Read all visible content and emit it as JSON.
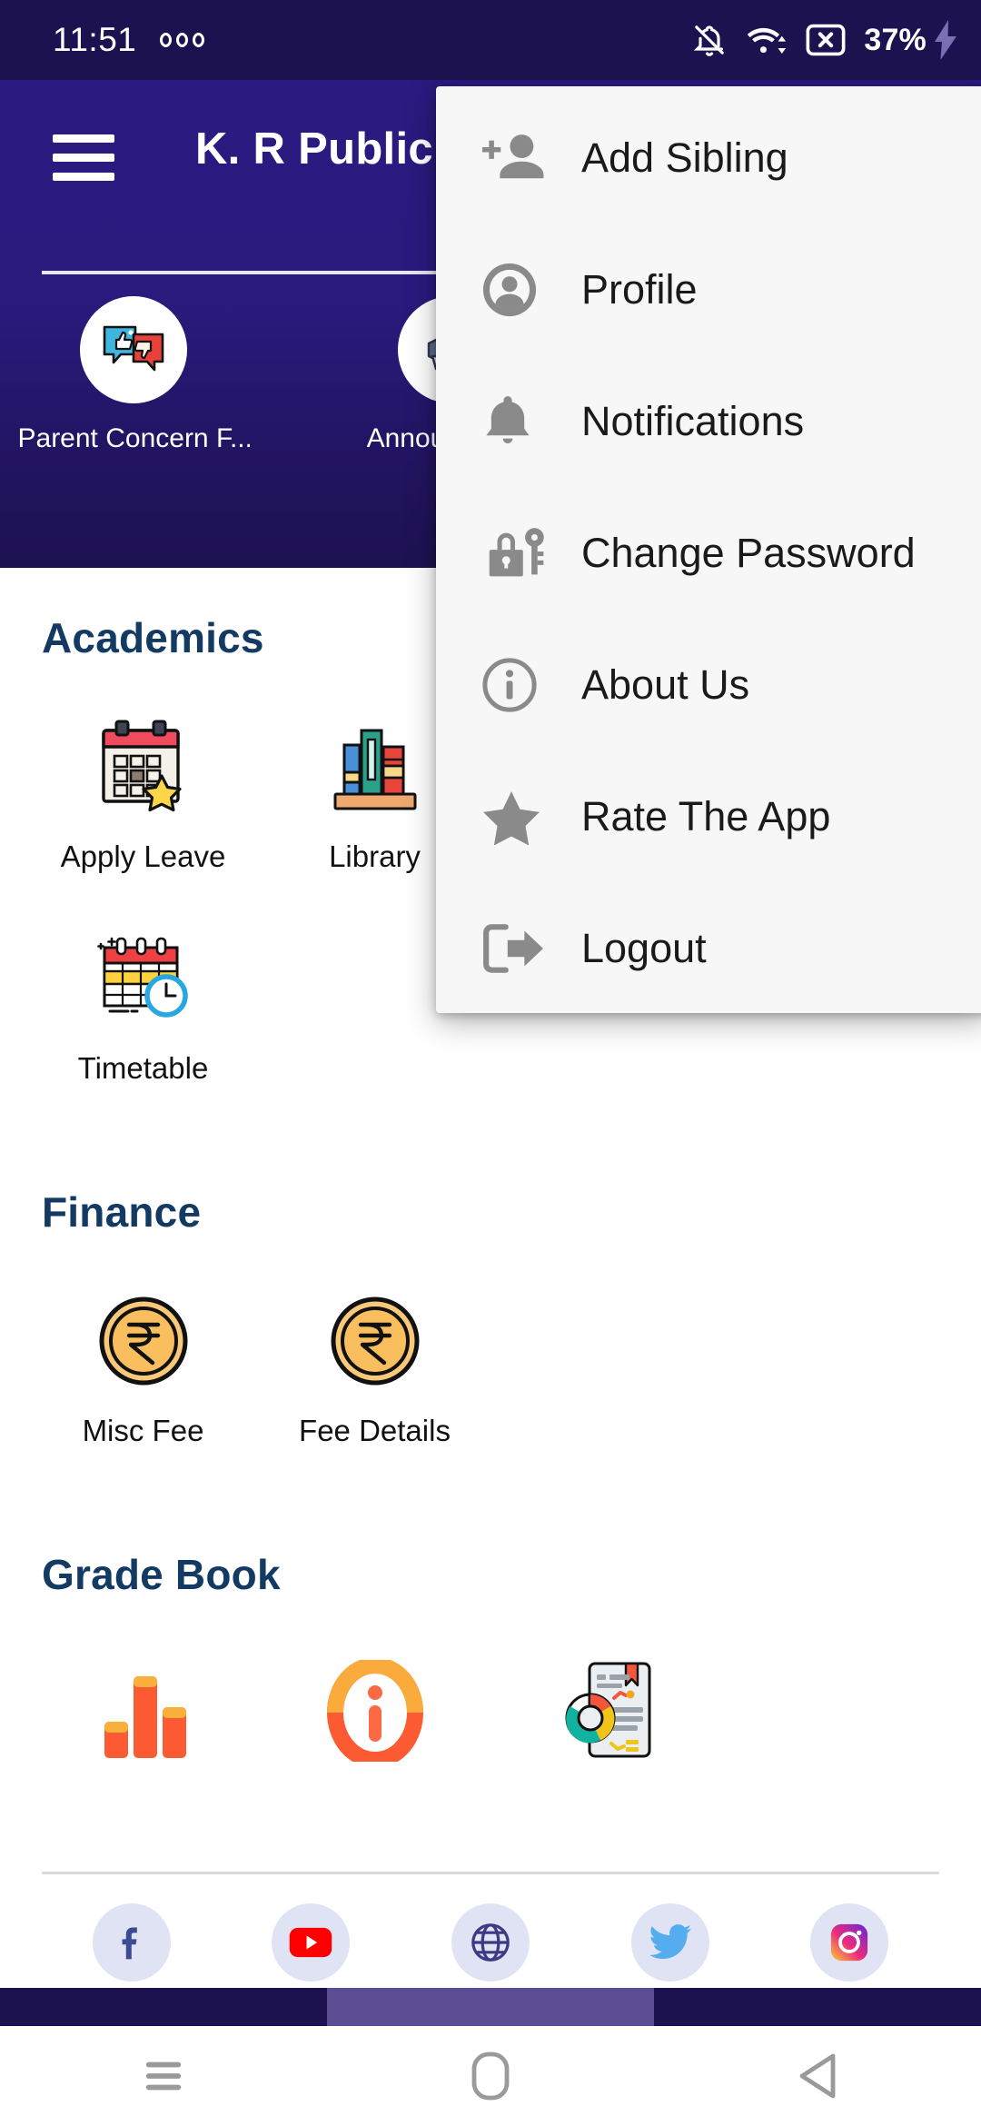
{
  "status_bar": {
    "time": "11:51",
    "dots_icon": "three-dots-icon",
    "notifications_muted_icon": "bell-off-icon",
    "wifi_icon": "wifi-icon",
    "sim_icon": "sim-card-x-icon",
    "battery_percent": "37%",
    "charging_icon": "charging-bolt-icon"
  },
  "app_bar": {
    "menu_icon": "hamburger-menu-icon",
    "title": "K. R Public",
    "quick_tiles": [
      {
        "label": "Parent Concern F...",
        "icon": "feedback-bubbles-icon"
      },
      {
        "label": "Announcemer",
        "icon": "megaphone-icon"
      }
    ]
  },
  "sections": [
    {
      "title": "Academics",
      "items": [
        {
          "label": "Apply Leave",
          "icon": "calendar-star-icon"
        },
        {
          "label": "Library",
          "icon": "books-shelf-icon"
        },
        {
          "label": "Timetable",
          "icon": "calendar-clock-icon"
        }
      ]
    },
    {
      "title": "Finance",
      "items": [
        {
          "label": "Misc Fee",
          "icon": "rupee-coin-icon"
        },
        {
          "label": "Fee Details",
          "icon": "rupee-coin-icon"
        }
      ]
    },
    {
      "title": "Grade Book",
      "items": [
        {
          "label": "",
          "icon": "bar-chart-icon"
        },
        {
          "label": "",
          "icon": "info-circle-orange-icon"
        },
        {
          "label": "",
          "icon": "report-card-donut-icon"
        }
      ]
    }
  ],
  "social_links": [
    {
      "name": "facebook",
      "icon": "facebook-icon"
    },
    {
      "name": "youtube",
      "icon": "youtube-icon"
    },
    {
      "name": "website",
      "icon": "globe-icon"
    },
    {
      "name": "twitter",
      "icon": "twitter-icon"
    },
    {
      "name": "instagram",
      "icon": "instagram-icon"
    }
  ],
  "overflow_menu": {
    "items": [
      {
        "label": "Add Sibling",
        "icon": "person-add-icon"
      },
      {
        "label": "Profile",
        "icon": "account-circle-icon"
      },
      {
        "label": "Notifications",
        "icon": "bell-icon"
      },
      {
        "label": "Change Password",
        "icon": "lock-key-icon"
      },
      {
        "label": "About Us",
        "icon": "info-circle-icon"
      },
      {
        "label": "Rate The App",
        "icon": "star-icon"
      },
      {
        "label": "Logout",
        "icon": "logout-arrow-icon"
      }
    ]
  },
  "system_nav": {
    "recents_icon": "recents-icon",
    "home_icon": "home-icon",
    "back_icon": "back-icon"
  },
  "colors": {
    "status_bar_bg": "#1d1250",
    "app_bar_top": "#2b1a80",
    "app_bar_bottom": "#1d1250",
    "section_heading": "#133a63",
    "menu_bg": "#f7f7f8",
    "menu_icon_gray": "#8a8a8a",
    "social_chip_bg": "#dfe3f3"
  }
}
